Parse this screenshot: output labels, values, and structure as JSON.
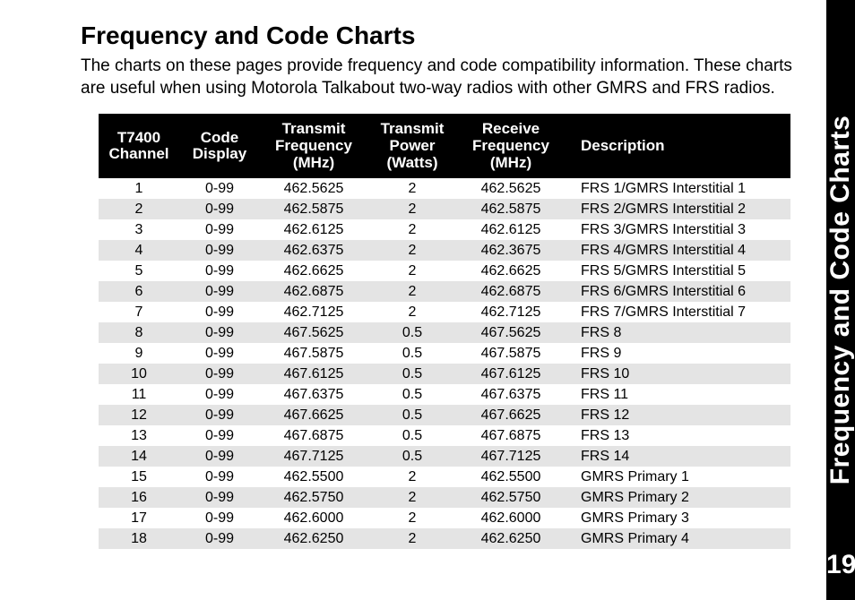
{
  "title": "Frequency and Code Charts",
  "intro": "The charts on these pages provide frequency and code compatibility information. These charts are useful when using Motorola Talkabout two-way radios with other GMRS and FRS radios.",
  "side_tab_label": "Frequency and Code Charts",
  "page_number": "19",
  "table": {
    "headers": {
      "col1": "T7400\nChannel",
      "col2": "Code\nDisplay",
      "col3": "Transmit\nFrequency\n(MHz)",
      "col4": "Transmit\nPower\n(Watts)",
      "col5": "Receive\nFrequency\n(MHz)",
      "col6": "Description"
    },
    "rows": [
      {
        "channel": "1",
        "code": "0-99",
        "tx_freq": "462.5625",
        "tx_pow": "2",
        "rx_freq": "462.5625",
        "desc": "FRS 1/GMRS Interstitial 1"
      },
      {
        "channel": "2",
        "code": "0-99",
        "tx_freq": "462.5875",
        "tx_pow": "2",
        "rx_freq": "462.5875",
        "desc": "FRS 2/GMRS Interstitial 2"
      },
      {
        "channel": "3",
        "code": "0-99",
        "tx_freq": "462.6125",
        "tx_pow": "2",
        "rx_freq": "462.6125",
        "desc": "FRS 3/GMRS Interstitial 3"
      },
      {
        "channel": "4",
        "code": "0-99",
        "tx_freq": "462.6375",
        "tx_pow": "2",
        "rx_freq": "462.3675",
        "desc": "FRS 4/GMRS Interstitial 4"
      },
      {
        "channel": "5",
        "code": "0-99",
        "tx_freq": "462.6625",
        "tx_pow": "2",
        "rx_freq": "462.6625",
        "desc": "FRS 5/GMRS Interstitial 5"
      },
      {
        "channel": "6",
        "code": "0-99",
        "tx_freq": "462.6875",
        "tx_pow": "2",
        "rx_freq": "462.6875",
        "desc": "FRS 6/GMRS Interstitial 6"
      },
      {
        "channel": "7",
        "code": "0-99",
        "tx_freq": "462.7125",
        "tx_pow": "2",
        "rx_freq": "462.7125",
        "desc": "FRS 7/GMRS Interstitial 7"
      },
      {
        "channel": "8",
        "code": "0-99",
        "tx_freq": "467.5625",
        "tx_pow": "0.5",
        "rx_freq": "467.5625",
        "desc": "FRS 8"
      },
      {
        "channel": "9",
        "code": "0-99",
        "tx_freq": "467.5875",
        "tx_pow": "0.5",
        "rx_freq": "467.5875",
        "desc": "FRS 9"
      },
      {
        "channel": "10",
        "code": "0-99",
        "tx_freq": "467.6125",
        "tx_pow": "0.5",
        "rx_freq": "467.6125",
        "desc": "FRS 10"
      },
      {
        "channel": "11",
        "code": "0-99",
        "tx_freq": "467.6375",
        "tx_pow": "0.5",
        "rx_freq": "467.6375",
        "desc": "FRS 11"
      },
      {
        "channel": "12",
        "code": "0-99",
        "tx_freq": "467.6625",
        "tx_pow": "0.5",
        "rx_freq": "467.6625",
        "desc": "FRS 12"
      },
      {
        "channel": "13",
        "code": "0-99",
        "tx_freq": "467.6875",
        "tx_pow": "0.5",
        "rx_freq": "467.6875",
        "desc": "FRS 13"
      },
      {
        "channel": "14",
        "code": "0-99",
        "tx_freq": "467.7125",
        "tx_pow": "0.5",
        "rx_freq": "467.7125",
        "desc": "FRS 14"
      },
      {
        "channel": "15",
        "code": "0-99",
        "tx_freq": "462.5500",
        "tx_pow": "2",
        "rx_freq": "462.5500",
        "desc": "GMRS Primary 1"
      },
      {
        "channel": "16",
        "code": "0-99",
        "tx_freq": "462.5750",
        "tx_pow": "2",
        "rx_freq": "462.5750",
        "desc": "GMRS Primary 2"
      },
      {
        "channel": "17",
        "code": "0-99",
        "tx_freq": "462.6000",
        "tx_pow": "2",
        "rx_freq": "462.6000",
        "desc": "GMRS Primary 3"
      },
      {
        "channel": "18",
        "code": "0-99",
        "tx_freq": "462.6250",
        "tx_pow": "2",
        "rx_freq": "462.6250",
        "desc": "GMRS Primary 4"
      }
    ]
  },
  "chart_data": {
    "type": "table",
    "title": "Frequency and Code Charts",
    "columns": [
      "T7400 Channel",
      "Code Display",
      "Transmit Frequency (MHz)",
      "Transmit Power (Watts)",
      "Receive Frequency (MHz)",
      "Description"
    ],
    "rows": [
      [
        1,
        "0-99",
        462.5625,
        2,
        462.5625,
        "FRS 1/GMRS Interstitial 1"
      ],
      [
        2,
        "0-99",
        462.5875,
        2,
        462.5875,
        "FRS 2/GMRS Interstitial 2"
      ],
      [
        3,
        "0-99",
        462.6125,
        2,
        462.6125,
        "FRS 3/GMRS Interstitial 3"
      ],
      [
        4,
        "0-99",
        462.6375,
        2,
        462.3675,
        "FRS 4/GMRS Interstitial 4"
      ],
      [
        5,
        "0-99",
        462.6625,
        2,
        462.6625,
        "FRS 5/GMRS Interstitial 5"
      ],
      [
        6,
        "0-99",
        462.6875,
        2,
        462.6875,
        "FRS 6/GMRS Interstitial 6"
      ],
      [
        7,
        "0-99",
        462.7125,
        2,
        462.7125,
        "FRS 7/GMRS Interstitial 7"
      ],
      [
        8,
        "0-99",
        467.5625,
        0.5,
        467.5625,
        "FRS 8"
      ],
      [
        9,
        "0-99",
        467.5875,
        0.5,
        467.5875,
        "FRS 9"
      ],
      [
        10,
        "0-99",
        467.6125,
        0.5,
        467.6125,
        "FRS 10"
      ],
      [
        11,
        "0-99",
        467.6375,
        0.5,
        467.6375,
        "FRS 11"
      ],
      [
        12,
        "0-99",
        467.6625,
        0.5,
        467.6625,
        "FRS 12"
      ],
      [
        13,
        "0-99",
        467.6875,
        0.5,
        467.6875,
        "FRS 13"
      ],
      [
        14,
        "0-99",
        467.7125,
        0.5,
        467.7125,
        "FRS 14"
      ],
      [
        15,
        "0-99",
        462.55,
        2,
        462.55,
        "GMRS Primary 1"
      ],
      [
        16,
        "0-99",
        462.575,
        2,
        462.575,
        "GMRS Primary 2"
      ],
      [
        17,
        "0-99",
        462.6,
        2,
        462.6,
        "GMRS Primary 3"
      ],
      [
        18,
        "0-99",
        462.625,
        2,
        462.625,
        "GMRS Primary 4"
      ]
    ]
  }
}
